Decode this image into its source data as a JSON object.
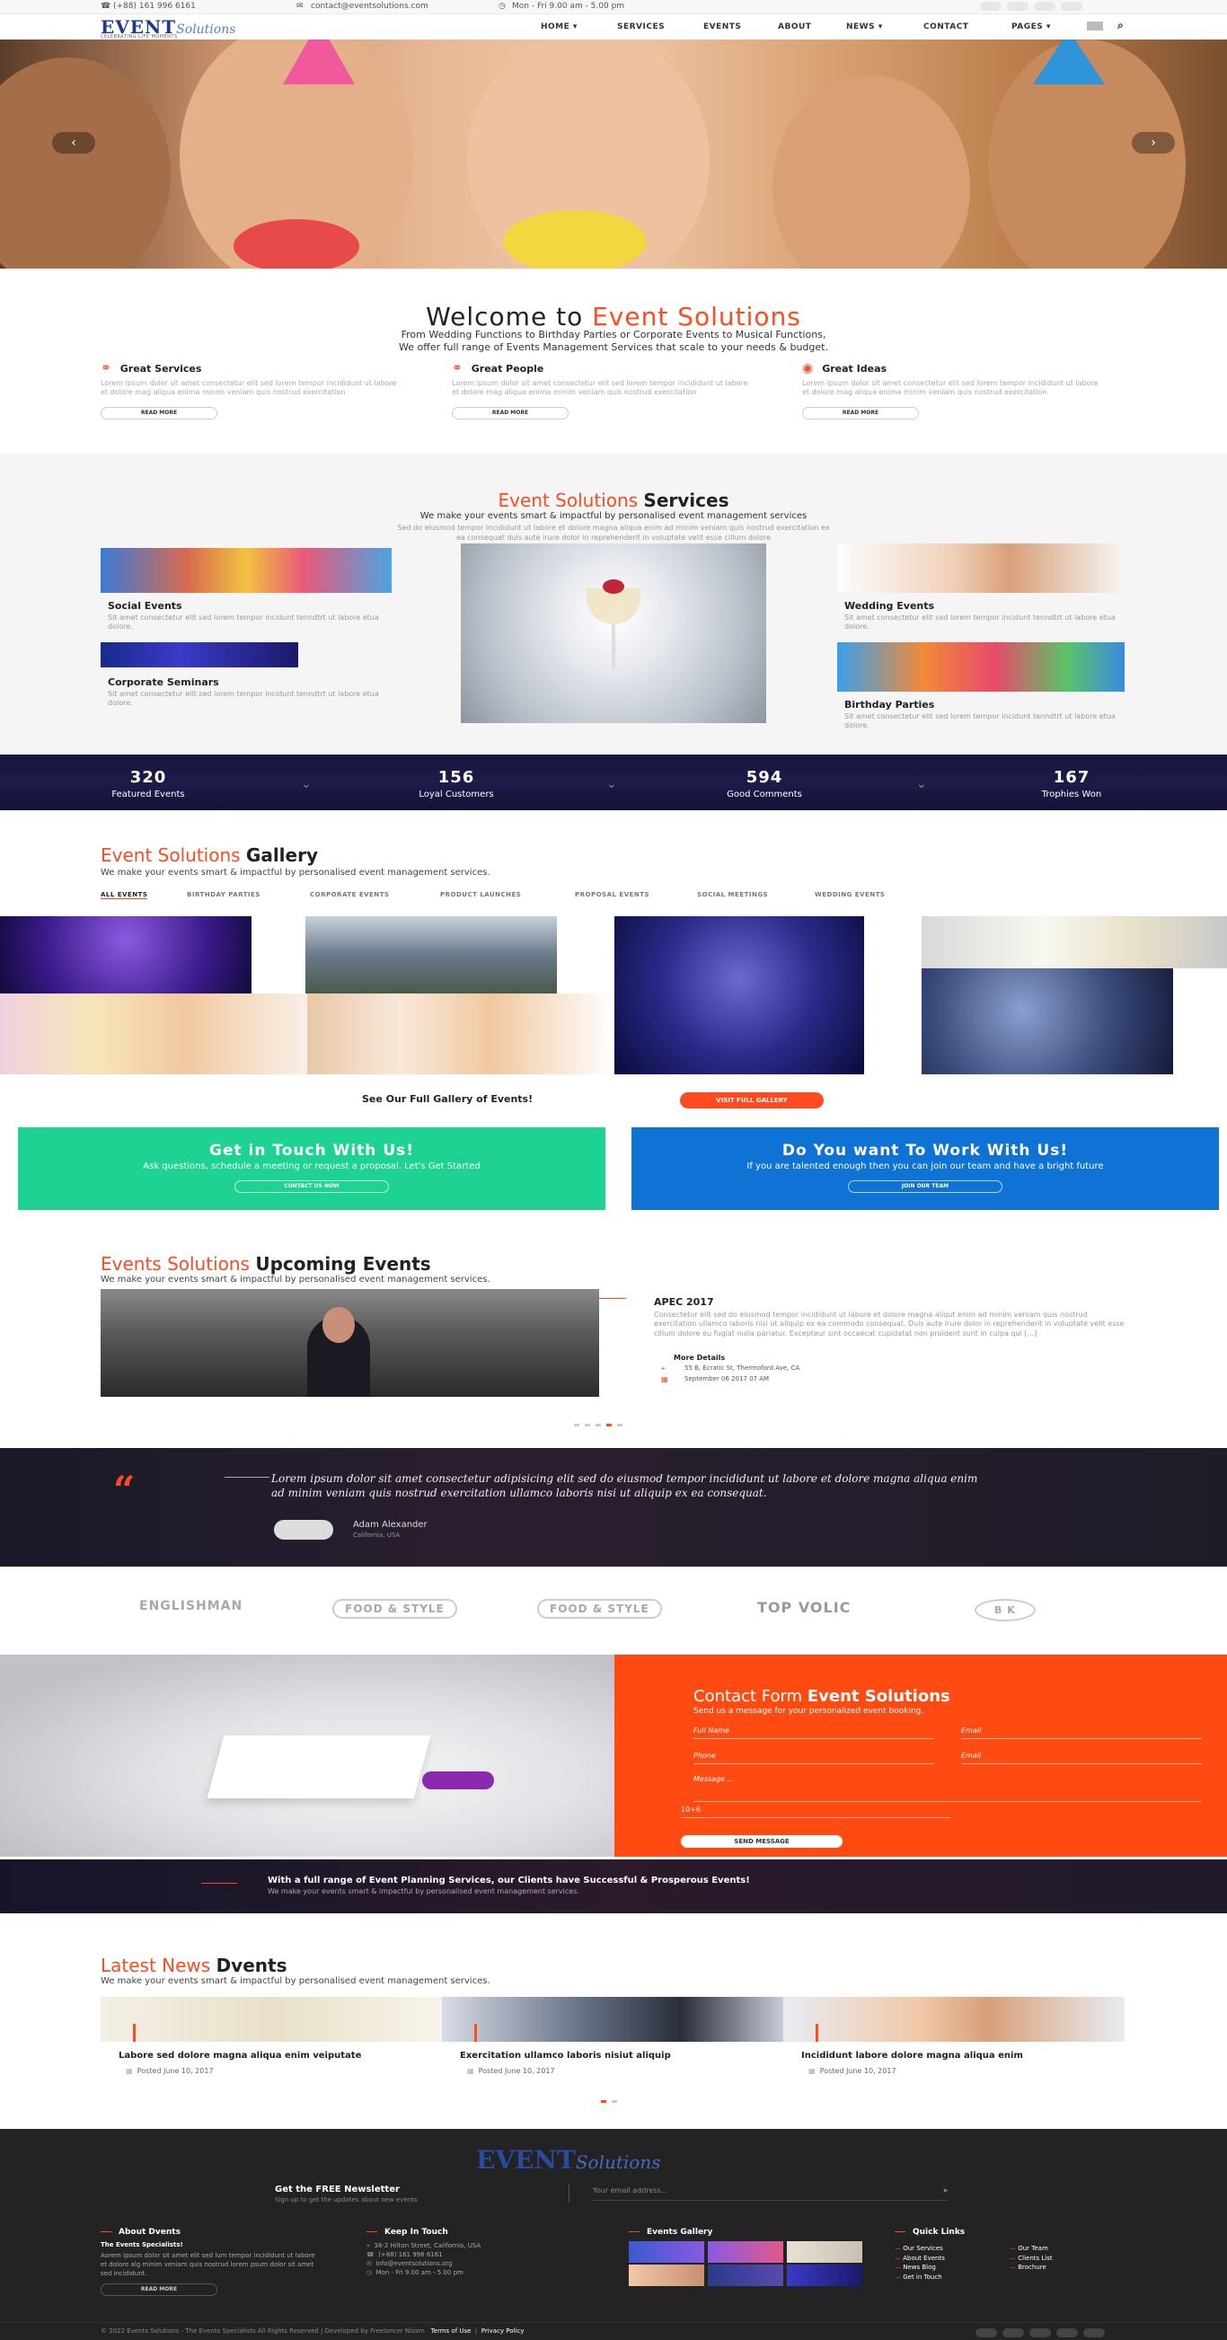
{
  "topbar": {
    "phone": "(+88) 161 996 6161",
    "email": "contact@eventsolutions.com",
    "hours": "Mon - Fri 9.00 am - 5.00 pm"
  },
  "header": {
    "logo": "EVENT",
    "logo_italic": "Solutions",
    "logo_tag": "CELEBRATING LIFE MOMENTS",
    "nav": [
      "HOME",
      "SERVICES",
      "EVENTS",
      "ABOUT",
      "NEWS",
      "CONTACT",
      "PAGES"
    ]
  },
  "welcome": {
    "title_a": "Welcome to ",
    "title_b": "Event Solutions",
    "line1": "From Wedding Functions to Birthday Parties or Corporate Events to Musical Functions,",
    "line2": "We offer full range of Events Management Services that scale to your needs & budget.",
    "features": [
      {
        "title": "Great Services",
        "text": "Lorem ipsum dolor sit amet consectetur elit sed lorem tempor incididunt ut labore et dolore mag aliqua enima minim veniam quis nostrud exercitation",
        "btn": "READ MORE"
      },
      {
        "title": "Great People",
        "text": "Lorem ipsum dolor sit amet consectetur elit sed lorem tempor incididunt ut labore et dolore mag aliqua enima minim veniam quis nostrud exercitation",
        "btn": "READ MORE"
      },
      {
        "title": "Great Ideas",
        "text": "Lorem ipsum dolor sit amet consectetur elit sed lorem tempor incididunt ut labore et dolore mag aliqua enima minim veniam quis nostrud exercitation",
        "btn": "READ MORE"
      }
    ]
  },
  "services": {
    "title_a": "Event Solutions ",
    "title_b": "Services",
    "sub": "We make your events smart & impactful by personalised event management services",
    "desc1": "Sed do eiusmod tempor incididunt ut labore et dolore magna aliqua enim ad minim veniam quis nostrud exercitation ex",
    "desc2": "ea consequat duis aute irure dolor in reprehenderit in voluptate velit esse cillum dolore",
    "items": [
      {
        "title": "Social Events",
        "text": "Sit amet consectetur elit sed lorem tempor incidunt tenndtrt ut labore etua dolore."
      },
      {
        "title": "Corporate Seminars",
        "text": "Sit amet consectetur elit sed lorem tempor incidunt tenndtrt ut labore etua dolore."
      },
      {
        "title": "Wedding Events",
        "text": "Sit amet consectetur elit sed lorem tempor incidunt tenndtrt ut labore etua dolore."
      },
      {
        "title": "Birthday Parties",
        "text": "Sit amet consectetur elit sed lorem tempor incidunt tenndtrt ut labore etua dolore."
      }
    ]
  },
  "counters": [
    {
      "n": "320",
      "l": "Featured Events"
    },
    {
      "n": "156",
      "l": "Loyal Customers"
    },
    {
      "n": "594",
      "l": "Good Comments"
    },
    {
      "n": "167",
      "l": "Trophies Won"
    }
  ],
  "gallery": {
    "title_a": "Event Solutions ",
    "title_b": "Gallery",
    "sub": "We make your events smart & impactful by personalised event management services.",
    "filters": [
      "ALL EVENTS",
      "BIRTHDAY PARTIES",
      "CORPORATE EVENTS",
      "PRODUCT LAUNCHES",
      "PROPOSAL EVENTS",
      "SOCIAL MEETINGS",
      "WEDDING EVENTS"
    ],
    "cta_text": "See Our Full Gallery of Events!",
    "cta_btn": "VISIT FULL GALLERY"
  },
  "cta": {
    "left_title": "Get in Touch With Us!",
    "left_text": "Ask questions, schedule a meeting or request a proposal. Let's Get Started",
    "left_btn": "CONTACT US NOW",
    "right_title": "Do You want To Work With Us!",
    "right_text": "If you are talented enough then you can join our team and have a bright future",
    "right_btn": "JOIN OUR TEAM",
    "left_color": "#1ed391",
    "right_color": "#0f73d6"
  },
  "upcoming": {
    "title_a": "Events Solutions ",
    "title_b": "Upcoming Events",
    "sub": "We make your events smart & impactful by personalised event management services.",
    "event_title": "APEC 2017",
    "event_text": "Consectetur elit sed do eiusmod tempor incididunt ut labore et dolore magna aliqut enim ad minim veniam quis nostrud exercitation ullamco laboris nisi ut aliquip ex ea commodo consequat. Duis aute irure dolor in reprehenderit in voluptate velit esse cillum dolore eu fugiat nulla pariatur. Excepteur sint occaecat cupidatat non proident sunt in culpa qui [...]",
    "more": "More Details",
    "address": "55 B, Ecratic St, Thermoford Ave, CA",
    "date": "September 06 2017 07 AM"
  },
  "testimonial": {
    "quote": "Lorem ipsum dolor sit amet consectetur adipisicing elit sed do eiusmod tempor incididunt ut labore et dolore magna aliqua enim ad minim veniam quis nostrud exercitation ullamco laboris nisi ut aliquip ex ea consequat.",
    "name": "Adam Alexander",
    "loc": "California, USA"
  },
  "clients": [
    "ENGLISHMAN",
    "FOOD & STYLE",
    "FOOD & STYLE",
    "TOP VOLIC",
    "B K"
  ],
  "contact": {
    "title_a": "Contact Form ",
    "title_b": "Event Solutions",
    "sub": "Send us a message for your personalized event booking.",
    "full_name": "Full Name",
    "email": "Email",
    "phone": "Phone",
    "email2": "Email",
    "message": "Message ...",
    "captcha": "10+6",
    "btn": "SEND MESSAGE",
    "color": "#ff4b12"
  },
  "banner": {
    "title": "With a full range of Event Planning Services, our Clients have Successful & Prosperous Events!",
    "sub": "We make your events smart & impactful by personalised event management services."
  },
  "news": {
    "title_a": "Latest News ",
    "title_b": "Dvents",
    "sub": "We make your events smart & impactful by personalised event management services.",
    "items": [
      {
        "title": "Labore sed dolore magna aliqua enim veiputate",
        "date": "Posted June 10, 2017"
      },
      {
        "title": "Exercitation ullamco laboris nisiut aliquip",
        "date": "Posted June 10, 2017"
      },
      {
        "title": "Incididunt labore dolore magna aliqua enim",
        "date": "Posted June 10, 2017"
      }
    ]
  },
  "footer": {
    "logo": "EVENT",
    "logo_italic": "Solutions",
    "nl_title": "Get the FREE Newsletter",
    "nl_sub": "Sign up to get the updates about new events",
    "nl_placeholder": "Your email address...",
    "about_h": "About Dvents",
    "about_t": "The Events Specialists!",
    "about_p": "Aorem ipsum dolor sit amet elit sed lum tempor incididunt ut labore et dolore alg minim veniam quis nostrud lorem psum dolor sit amet sed incididunt.",
    "about_btn": "READ MORE",
    "touch_h": "Keep In Touch",
    "touch": [
      "38-2 Hilton Street, California, USA",
      "(+88) 161 996 6161",
      "info@eventsolutions.org",
      "Mon - Fri 9.00 am - 5.00 pm"
    ],
    "gal_h": "Events Gallery",
    "links_h": "Quick Links",
    "links_a": [
      "Our Services",
      "About Events",
      "News Blog",
      "Get in Touch"
    ],
    "links_b": [
      "Our Team",
      "Clients List",
      "Brochure"
    ],
    "copy": "© 2022 Events Solutions - The Events Specialists All Rights Reserved | Developed by Freelancer Nizam",
    "terms": "Terms of Use",
    "privacy": "Privacy Policy"
  }
}
